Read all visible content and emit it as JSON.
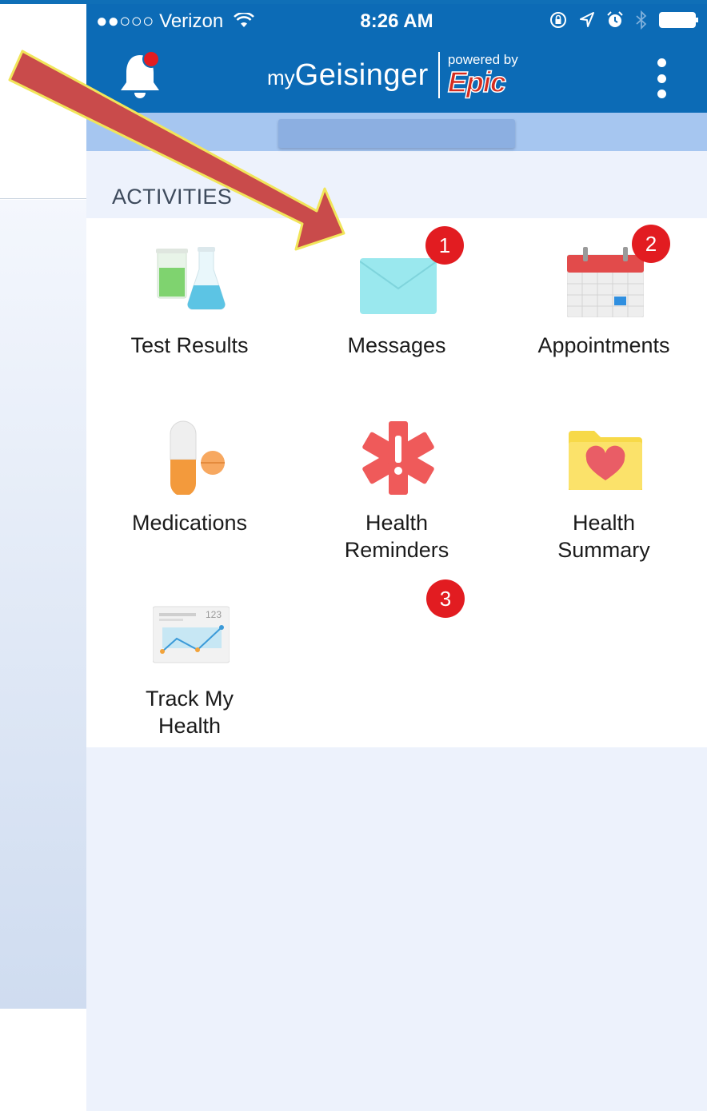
{
  "status_bar": {
    "carrier": "●●○○○ Verizon",
    "time": "8:26 AM"
  },
  "header": {
    "brand_my": "my",
    "brand_name": "Geisinger",
    "powered_by": "powered by",
    "epic": "Epic",
    "header_color": "#0c6bb6",
    "epic_color": "#d52b1e"
  },
  "section": {
    "title": "ACTIVITIES"
  },
  "tiles": [
    {
      "label": "Test Results",
      "icon": "test-tubes-icon",
      "badge": ""
    },
    {
      "label": "Messages",
      "icon": "envelope-icon",
      "badge": "1"
    },
    {
      "label": "Appointments",
      "icon": "calendar-icon",
      "badge": "2"
    },
    {
      "label": "Medications",
      "icon": "pill-icon",
      "badge": ""
    },
    {
      "label": "Health Reminders",
      "icon": "medical-alert-icon",
      "badge": "3"
    },
    {
      "label": "Health Summary",
      "icon": "heart-folder-icon",
      "badge": ""
    },
    {
      "label": "Track My Health",
      "icon": "chart-icon",
      "badge": ""
    }
  ],
  "badge_color": "#e21c21",
  "chart_icon_text": "123"
}
